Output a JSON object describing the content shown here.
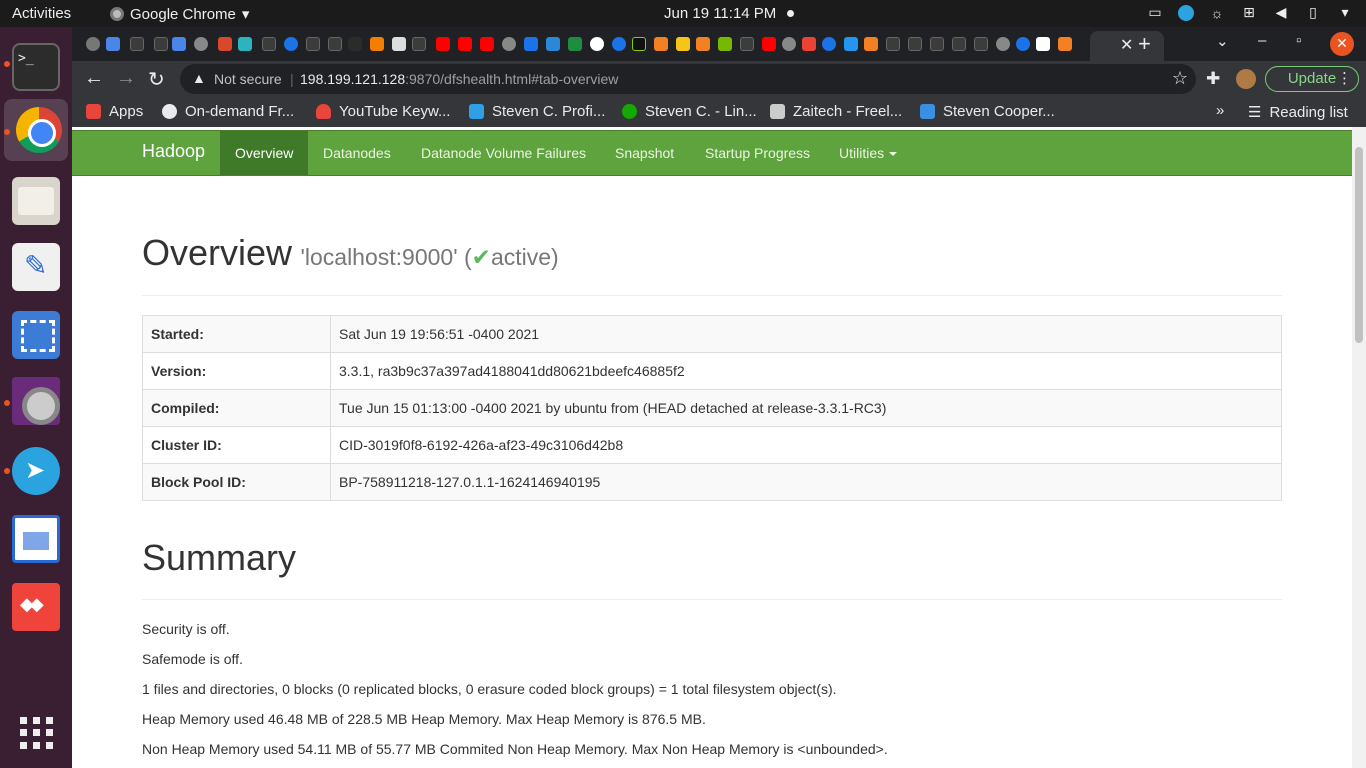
{
  "topbar": {
    "activities": "Activities",
    "app_name": "Google Chrome",
    "clock": "Jun 19  11:14 PM"
  },
  "dock": {
    "items": [
      "terminal",
      "google-chrome",
      "files",
      "text-editor",
      "screenshot",
      "video-player",
      "telegram",
      "libreoffice-writer",
      "anydesk",
      "show-applications"
    ]
  },
  "browser": {
    "omnibox": {
      "security_label": "Not secure",
      "url_host": "198.199.121.128",
      "url_rest": ":9870/dfshealth.html#tab-overview"
    },
    "update_label": "Update",
    "bookmarks": [
      {
        "label": "Apps",
        "icon": "apps-grid-icon",
        "color": "#e8453c"
      },
      {
        "label": "On-demand Fr...",
        "icon": "globe-icon",
        "color": "#e8eaed"
      },
      {
        "label": "YouTube Keyw...",
        "icon": "flame-icon",
        "color": "#e8453c"
      },
      {
        "label": "Steven C. Profi...",
        "icon": "y-logo-icon",
        "color": "#2ea1e6"
      },
      {
        "label": "Steven C. - Lin...",
        "icon": "upwork-icon",
        "color": "#14a800"
      },
      {
        "label": "Zaitech - Freel...",
        "icon": "freelancer-icon",
        "color": "#cccccc"
      },
      {
        "label": "Steven Cooper...",
        "icon": "profile-card-icon",
        "color": "#3a8fe0"
      }
    ],
    "reading_list": "Reading list"
  },
  "hadoop_nav": {
    "brand": "Hadoop",
    "links": [
      "Overview",
      "Datanodes",
      "Datanode Volume Failures",
      "Snapshot",
      "Startup Progress",
      "Utilities"
    ],
    "active": "Overview"
  },
  "overview": {
    "title": "Overview",
    "host": "'localhost:9000' (",
    "status": "active)",
    "check": "✔",
    "rows": [
      {
        "label": "Started:",
        "value": "Sat Jun 19 19:56:51 -0400 2021"
      },
      {
        "label": "Version:",
        "value": "3.3.1, ra3b9c37a397ad4188041dd80621bdeefc46885f2"
      },
      {
        "label": "Compiled:",
        "value": "Tue Jun 15 01:13:00 -0400 2021 by ubuntu from (HEAD detached at release-3.3.1-RC3)"
      },
      {
        "label": "Cluster ID:",
        "value": "CID-3019f0f8-6192-426a-af23-49c3106d42b8"
      },
      {
        "label": "Block Pool ID:",
        "value": "BP-758911218-127.0.1.1-1624146940195"
      }
    ]
  },
  "summary": {
    "title": "Summary",
    "lines": [
      "Security is off.",
      "Safemode is off.",
      "1 files and directories, 0 blocks (0 replicated blocks, 0 erasure coded block groups) = 1 total filesystem object(s).",
      "Heap Memory used 46.48 MB of 228.5 MB Heap Memory. Max Heap Memory is 876.5 MB.",
      "Non Heap Memory used 54.11 MB of 55.77 MB Commited Non Heap Memory. Max Non Heap Memory is <unbounded>."
    ]
  },
  "colors": {
    "hadoop_nav": "#5fa33e",
    "hadoop_nav_active": "#3e7a28",
    "ubuntu_accent": "#e95420"
  }
}
